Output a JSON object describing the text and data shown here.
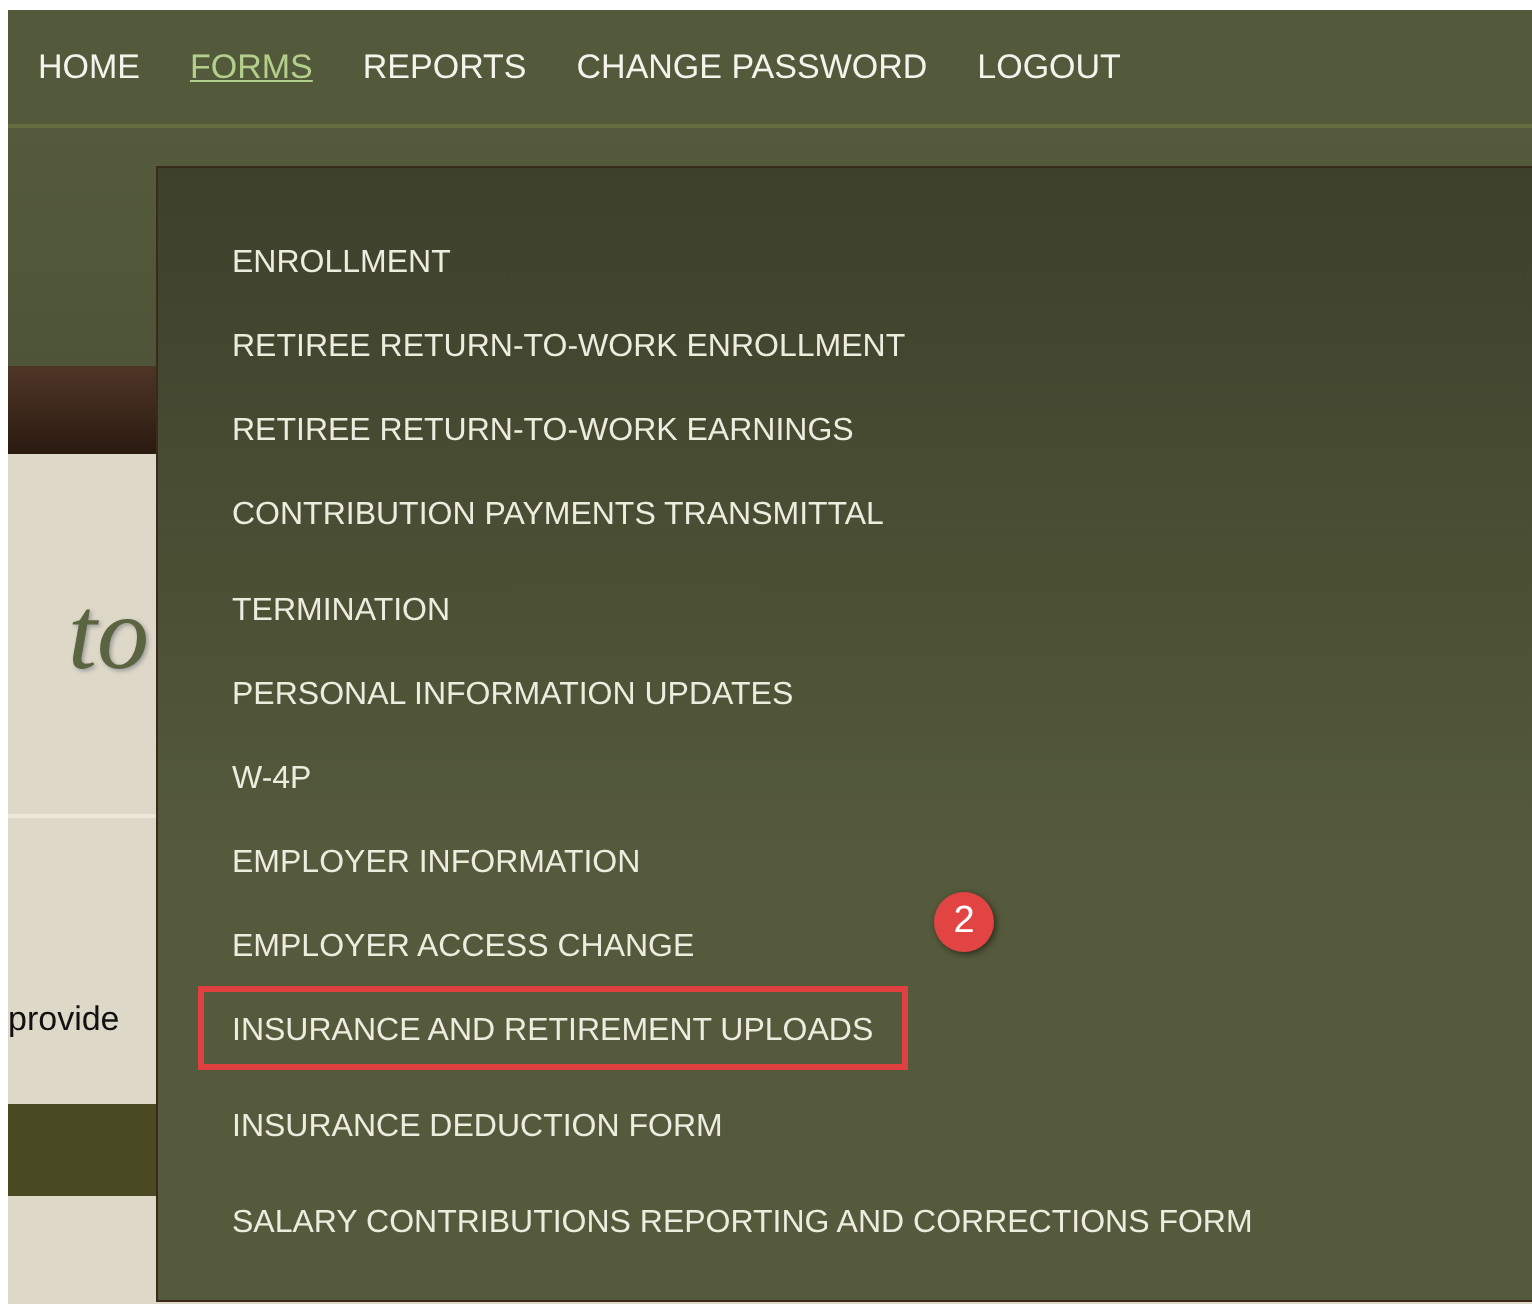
{
  "nav": [
    {
      "label": "HOME",
      "selected": false
    },
    {
      "label": "FORMS",
      "selected": true
    },
    {
      "label": "REPORTS",
      "selected": false
    },
    {
      "label": "CHANGE PASSWORD",
      "selected": false
    },
    {
      "label": "LOGOUT",
      "selected": false
    }
  ],
  "page": {
    "heading_fragment": "to",
    "text_fragment": "provide"
  },
  "forms_menu": {
    "items": [
      {
        "label": "ENROLLMENT",
        "highlighted": false
      },
      {
        "label": "RETIREE RETURN-TO-WORK ENROLLMENT",
        "highlighted": false
      },
      {
        "label": "RETIREE RETURN-TO-WORK EARNINGS",
        "highlighted": false
      },
      {
        "label": "CONTRIBUTION PAYMENTS TRANSMITTAL",
        "highlighted": false
      },
      {
        "label": "TERMINATION",
        "highlighted": false
      },
      {
        "label": "PERSONAL INFORMATION UPDATES",
        "highlighted": false
      },
      {
        "label": "W-4P",
        "highlighted": false
      },
      {
        "label": "EMPLOYER INFORMATION",
        "highlighted": false
      },
      {
        "label": "EMPLOYER ACCESS CHANGE",
        "highlighted": false
      },
      {
        "label": "INSURANCE AND RETIREMENT UPLOADS",
        "highlighted": true
      },
      {
        "label": "INSURANCE DEDUCTION FORM",
        "highlighted": false
      },
      {
        "label": "SALARY CONTRIBUTIONS REPORTING AND CORRECTIONS FORM",
        "highlighted": false
      }
    ],
    "step_badge": "2"
  }
}
